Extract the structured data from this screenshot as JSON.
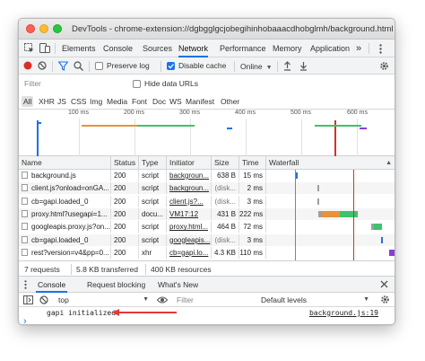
{
  "window": {
    "title": "DevTools - chrome-extension://dgbgglgcjobegihinhobaaacdhobglmh/background.html"
  },
  "tabs": [
    "Elements",
    "Console",
    "Sources",
    "Network",
    "Performance",
    "Memory",
    "Application"
  ],
  "active_tab": "Network",
  "more_tabs": "»",
  "toolbar": {
    "preserve_log": "Preserve log",
    "disable_cache": "Disable cache",
    "disable_cache_checked": true,
    "throttling": "Online"
  },
  "filter": {
    "placeholder": "Filter",
    "hide_data_urls": "Hide data URLs",
    "types": [
      "All",
      "XHR",
      "JS",
      "CSS",
      "Img",
      "Media",
      "Font",
      "Doc",
      "WS",
      "Manifest",
      "Other"
    ],
    "active_type": "All"
  },
  "overview": {
    "ticks": [
      "100 ms",
      "200 ms",
      "300 ms",
      "400 ms",
      "500 ms",
      "600 ms"
    ]
  },
  "table": {
    "columns": [
      "Name",
      "Status",
      "Type",
      "Initiator",
      "Size",
      "Time",
      "Waterfall"
    ],
    "rows": [
      {
        "name": "background.js",
        "status": "200",
        "type": "script",
        "initiator": "backgroun...",
        "size": "638 B",
        "time": "15 ms"
      },
      {
        "name": "client.js?onload=onGA...",
        "status": "200",
        "type": "script",
        "initiator": "backgroun...",
        "size": "(disk...",
        "time": "2 ms"
      },
      {
        "name": "cb=gapi.loaded_0",
        "status": "200",
        "type": "script",
        "initiator": "client.js?...",
        "size": "(disk...",
        "time": "3 ms"
      },
      {
        "name": "proxy.html?usegapi=1...",
        "status": "200",
        "type": "docu...",
        "initiator": "VM17:12",
        "size": "431 B",
        "time": "222 ms"
      },
      {
        "name": "googleapis.proxy.js?on...",
        "status": "200",
        "type": "script",
        "initiator": "proxy.html...",
        "size": "464 B",
        "time": "72 ms"
      },
      {
        "name": "cb=gapi.loaded_0",
        "status": "200",
        "type": "script",
        "initiator": "googleapis...",
        "size": "(disk...",
        "time": "3 ms"
      },
      {
        "name": "rest?version=v4&pp=0...",
        "status": "200",
        "type": "xhr",
        "initiator": "cb=gapi.lo...",
        "size": "4.3 KB",
        "time": "110 ms"
      }
    ]
  },
  "status": {
    "requests": "7 requests",
    "transferred": "5.8 KB transferred",
    "resources": "400 KB resources"
  },
  "drawer": {
    "tabs": [
      "Console",
      "Request blocking",
      "What's New"
    ],
    "active": "Console",
    "context": "top",
    "filter_placeholder": "Filter",
    "levels": "Default levels"
  },
  "console": {
    "message": "gapi initialized",
    "source": "background.js:19",
    "prompt": "›"
  },
  "colors": {
    "accent": "#1a73e8",
    "record": "#d93025",
    "arrow": "#e53935"
  }
}
